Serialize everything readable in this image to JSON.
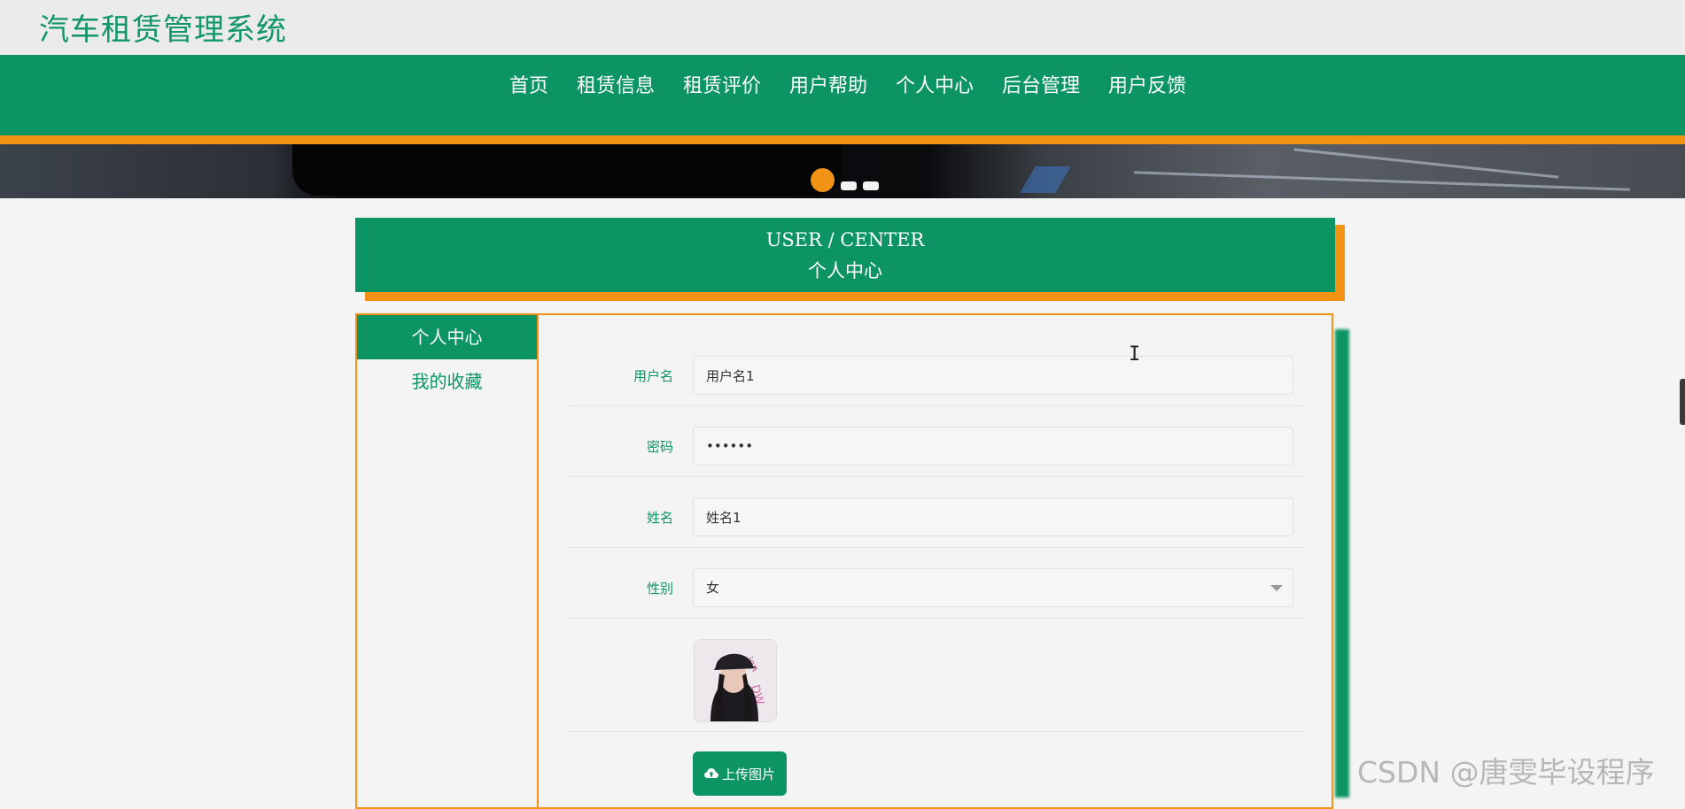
{
  "site": {
    "title": "汽车租赁管理系统"
  },
  "nav": {
    "items": [
      {
        "label": "首页"
      },
      {
        "label": "租赁信息"
      },
      {
        "label": "租赁评价"
      },
      {
        "label": "用户帮助"
      },
      {
        "label": "个人中心"
      },
      {
        "label": "后台管理"
      },
      {
        "label": "用户反馈"
      }
    ]
  },
  "carousel": {
    "active_index": 0,
    "count": 3
  },
  "page_header": {
    "title_en": "USER / CENTER",
    "title_cn": "个人中心"
  },
  "side_menu": {
    "items": [
      {
        "label": "个人中心",
        "active": true
      },
      {
        "label": "我的收藏",
        "active": false
      }
    ]
  },
  "form": {
    "username": {
      "label": "用户名",
      "value": "用户名1"
    },
    "password": {
      "label": "密码",
      "value": "••••••"
    },
    "name": {
      "label": "姓名",
      "value": "姓名1"
    },
    "gender": {
      "label": "性别",
      "value": "女"
    },
    "upload_button": "上传图片"
  },
  "watermark": "CSDN @唐雯毕设程序",
  "colors": {
    "brand_green": "#0c9563",
    "accent_orange": "#f39315",
    "title_green": "#11956a"
  }
}
